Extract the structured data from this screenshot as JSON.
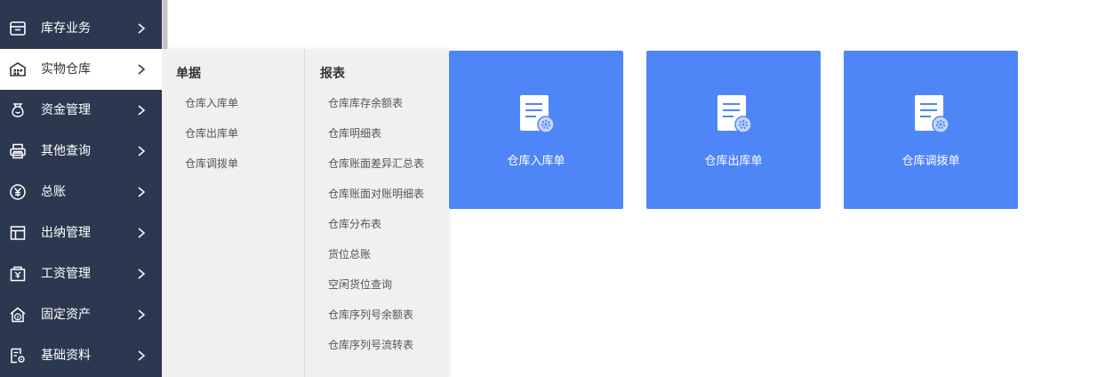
{
  "sidebar": {
    "items": [
      {
        "label": "库存业务",
        "icon": "inventory-box-icon"
      },
      {
        "label": "实物仓库",
        "icon": "warehouse-icon"
      },
      {
        "label": "资金管理",
        "icon": "money-bag-icon"
      },
      {
        "label": "其他查询",
        "icon": "printer-icon"
      },
      {
        "label": "总账",
        "icon": "yen-circle-icon"
      },
      {
        "label": "出纳管理",
        "icon": "layout-panel-icon"
      },
      {
        "label": "工资管理",
        "icon": "payroll-icon"
      },
      {
        "label": "固定资产",
        "icon": "house-yen-icon"
      },
      {
        "label": "基础资料",
        "icon": "document-settings-icon"
      }
    ],
    "active_index": 1
  },
  "flyout": {
    "documents": {
      "title": "单据",
      "items": [
        "仓库入库单",
        "仓库出库单",
        "仓库调拨单"
      ]
    },
    "reports": {
      "title": "报表",
      "items": [
        "仓库库存余额表",
        "仓库明细表",
        "仓库账面差异汇总表",
        "仓库账面对账明细表",
        "仓库分布表",
        "货位总账",
        "空闲货位查询",
        "仓库序列号余额表",
        "仓库序列号流转表"
      ]
    }
  },
  "tiles": [
    {
      "label": "仓库入库单"
    },
    {
      "label": "仓库出库单"
    },
    {
      "label": "仓库调拨单"
    }
  ],
  "colors": {
    "sidebar_bg": "#2b3850",
    "tile_bg": "#4e86f7",
    "flyout_bg": "#f0f0f0"
  }
}
